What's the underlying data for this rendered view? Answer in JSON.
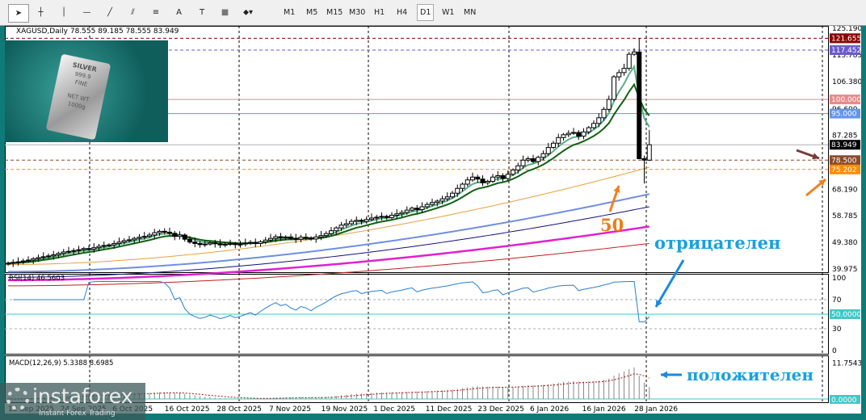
{
  "toolbar": {
    "tools": [
      "cursor",
      "crosshair",
      "vertical-line",
      "horizontal-line",
      "trendline",
      "equidistant-channel",
      "fibonacci",
      "text",
      "text-label",
      "rectangle",
      "arrows"
    ],
    "text_tool": "A",
    "timeframes": [
      "M1",
      "M5",
      "M15",
      "M30",
      "H1",
      "H4",
      "D1",
      "W1",
      "MN"
    ],
    "active_timeframe": "D1"
  },
  "chart": {
    "title": "XAGUSD,Daily  78.555 89.185 78.555 83.949",
    "price_ticks": [
      "125.190",
      "115.785",
      "106.380",
      "96.600",
      "87.285",
      "68.190",
      "58.785",
      "49.380",
      "39.975"
    ],
    "levels": [
      {
        "label": "121.655",
        "price": 121.655,
        "color": "#8b0000",
        "dash": true
      },
      {
        "label": "117.452",
        "price": 117.452,
        "color": "#6a5acd",
        "dash": true
      },
      {
        "label": "100.000",
        "price": 100,
        "color": "#e88a8a",
        "dash": false
      },
      {
        "label": "95.000",
        "price": 95,
        "color": "#6495ed",
        "dash": false
      },
      {
        "label": "83.949",
        "price": 83.949,
        "color": "#000000",
        "dash": false,
        "line": "#b0b0b0"
      },
      {
        "label": "78.500",
        "price": 78.5,
        "color": "#8b4a2b",
        "dash": true
      },
      {
        "label": "75.202",
        "price": 75.202,
        "color": "#ff8c00",
        "dash": true
      }
    ],
    "closes": [
      42.0,
      42.3,
      42.5,
      42.8,
      43.1,
      43.6,
      44.0,
      44.3,
      44.6,
      45.0,
      45.5,
      46.0,
      46.2,
      46.5,
      46.8,
      47.2,
      47.0,
      47.5,
      48.0,
      48.3,
      48.5,
      49.0,
      49.5,
      50.0,
      50.3,
      50.8,
      51.2,
      51.5,
      52.0,
      52.8,
      53.3,
      53.0,
      52.6,
      51.5,
      52.0,
      50.5,
      49.5,
      49.0,
      48.6,
      48.8,
      49.2,
      48.9,
      48.5,
      48.7,
      49.0,
      48.6,
      48.8,
      49.1,
      49.4,
      49.0,
      49.6,
      50.2,
      50.8,
      51.4,
      51.0,
      51.3,
      50.8,
      50.5,
      51.2,
      51.0,
      50.6,
      51.3,
      51.8,
      52.5,
      53.5,
      54.5,
      55.5,
      56.0,
      56.8,
      57.2,
      56.8,
      57.5,
      58.0,
      58.3,
      58.6,
      58.2,
      59.0,
      59.5,
      60.0,
      60.8,
      61.5,
      61.0,
      62.0,
      62.8,
      63.5,
      64.0,
      64.8,
      65.5,
      66.8,
      68.5,
      70.0,
      71.5,
      72.5,
      71.8,
      70.5,
      71.0,
      72.5,
      73.0,
      72.0,
      73.5,
      75.0,
      76.5,
      78.5,
      79.0,
      78.0,
      79.5,
      80.8,
      83.0,
      84.5,
      86.5,
      87.5,
      88.0,
      88.3,
      87.0,
      88.5,
      90.0,
      91.5,
      93.5,
      96.5,
      100.0,
      108.0,
      109.5,
      111.0,
      116.0,
      116.8,
      79.0,
      78.5,
      83.949
    ],
    "ma_lines": [
      {
        "name": "ma-50",
        "color": "#e8a040",
        "from": 41.5,
        "to": 76.0,
        "width": 1
      },
      {
        "name": "ma-100",
        "color": "#6f8fe0",
        "from": 39.0,
        "to": 66.5,
        "width": 2
      },
      {
        "name": "ma-navy",
        "color": "#101080",
        "from": 37.0,
        "to": 62.0,
        "width": 1
      },
      {
        "name": "ma-200",
        "color": "#e020d0",
        "from": 36.0,
        "to": 55.0,
        "width": 2.5
      },
      {
        "name": "ma-maroon",
        "color": "#c02020",
        "from": 34.0,
        "to": 49.0,
        "width": 1
      }
    ],
    "time_labels": [
      "12 Sep 2025",
      "24 Sep 2025",
      "6 Oct 2025",
      "16 Oct 2025",
      "28 Oct 2025",
      "7 Nov 2025",
      "19 Nov 2025",
      "1 Dec 2025",
      "11 Dec 2025",
      "23 Dec 2025",
      "6 Jan 2026",
      "16 Jan 2026",
      "28 Jan 2026"
    ]
  },
  "rsi": {
    "title": "RSI(14) 46.5603",
    "ticks": [
      "100",
      "70",
      "30",
      "0"
    ],
    "level_label": "50.0000"
  },
  "macd": {
    "title": "MACD(12,26,9) 5.3388 8.6985",
    "top_label": "11.7543",
    "zero_label": "0.0000"
  },
  "logo_image": {
    "text": [
      "SILVER",
      "999.9",
      "FINE",
      "NET WT",
      "1000g"
    ]
  },
  "watermark": {
    "brand": "instaforex",
    "tagline": "Instant Forex Trading"
  },
  "annotations": {
    "negative": "отрицателен",
    "positive": "положителен",
    "ma50": "50"
  }
}
